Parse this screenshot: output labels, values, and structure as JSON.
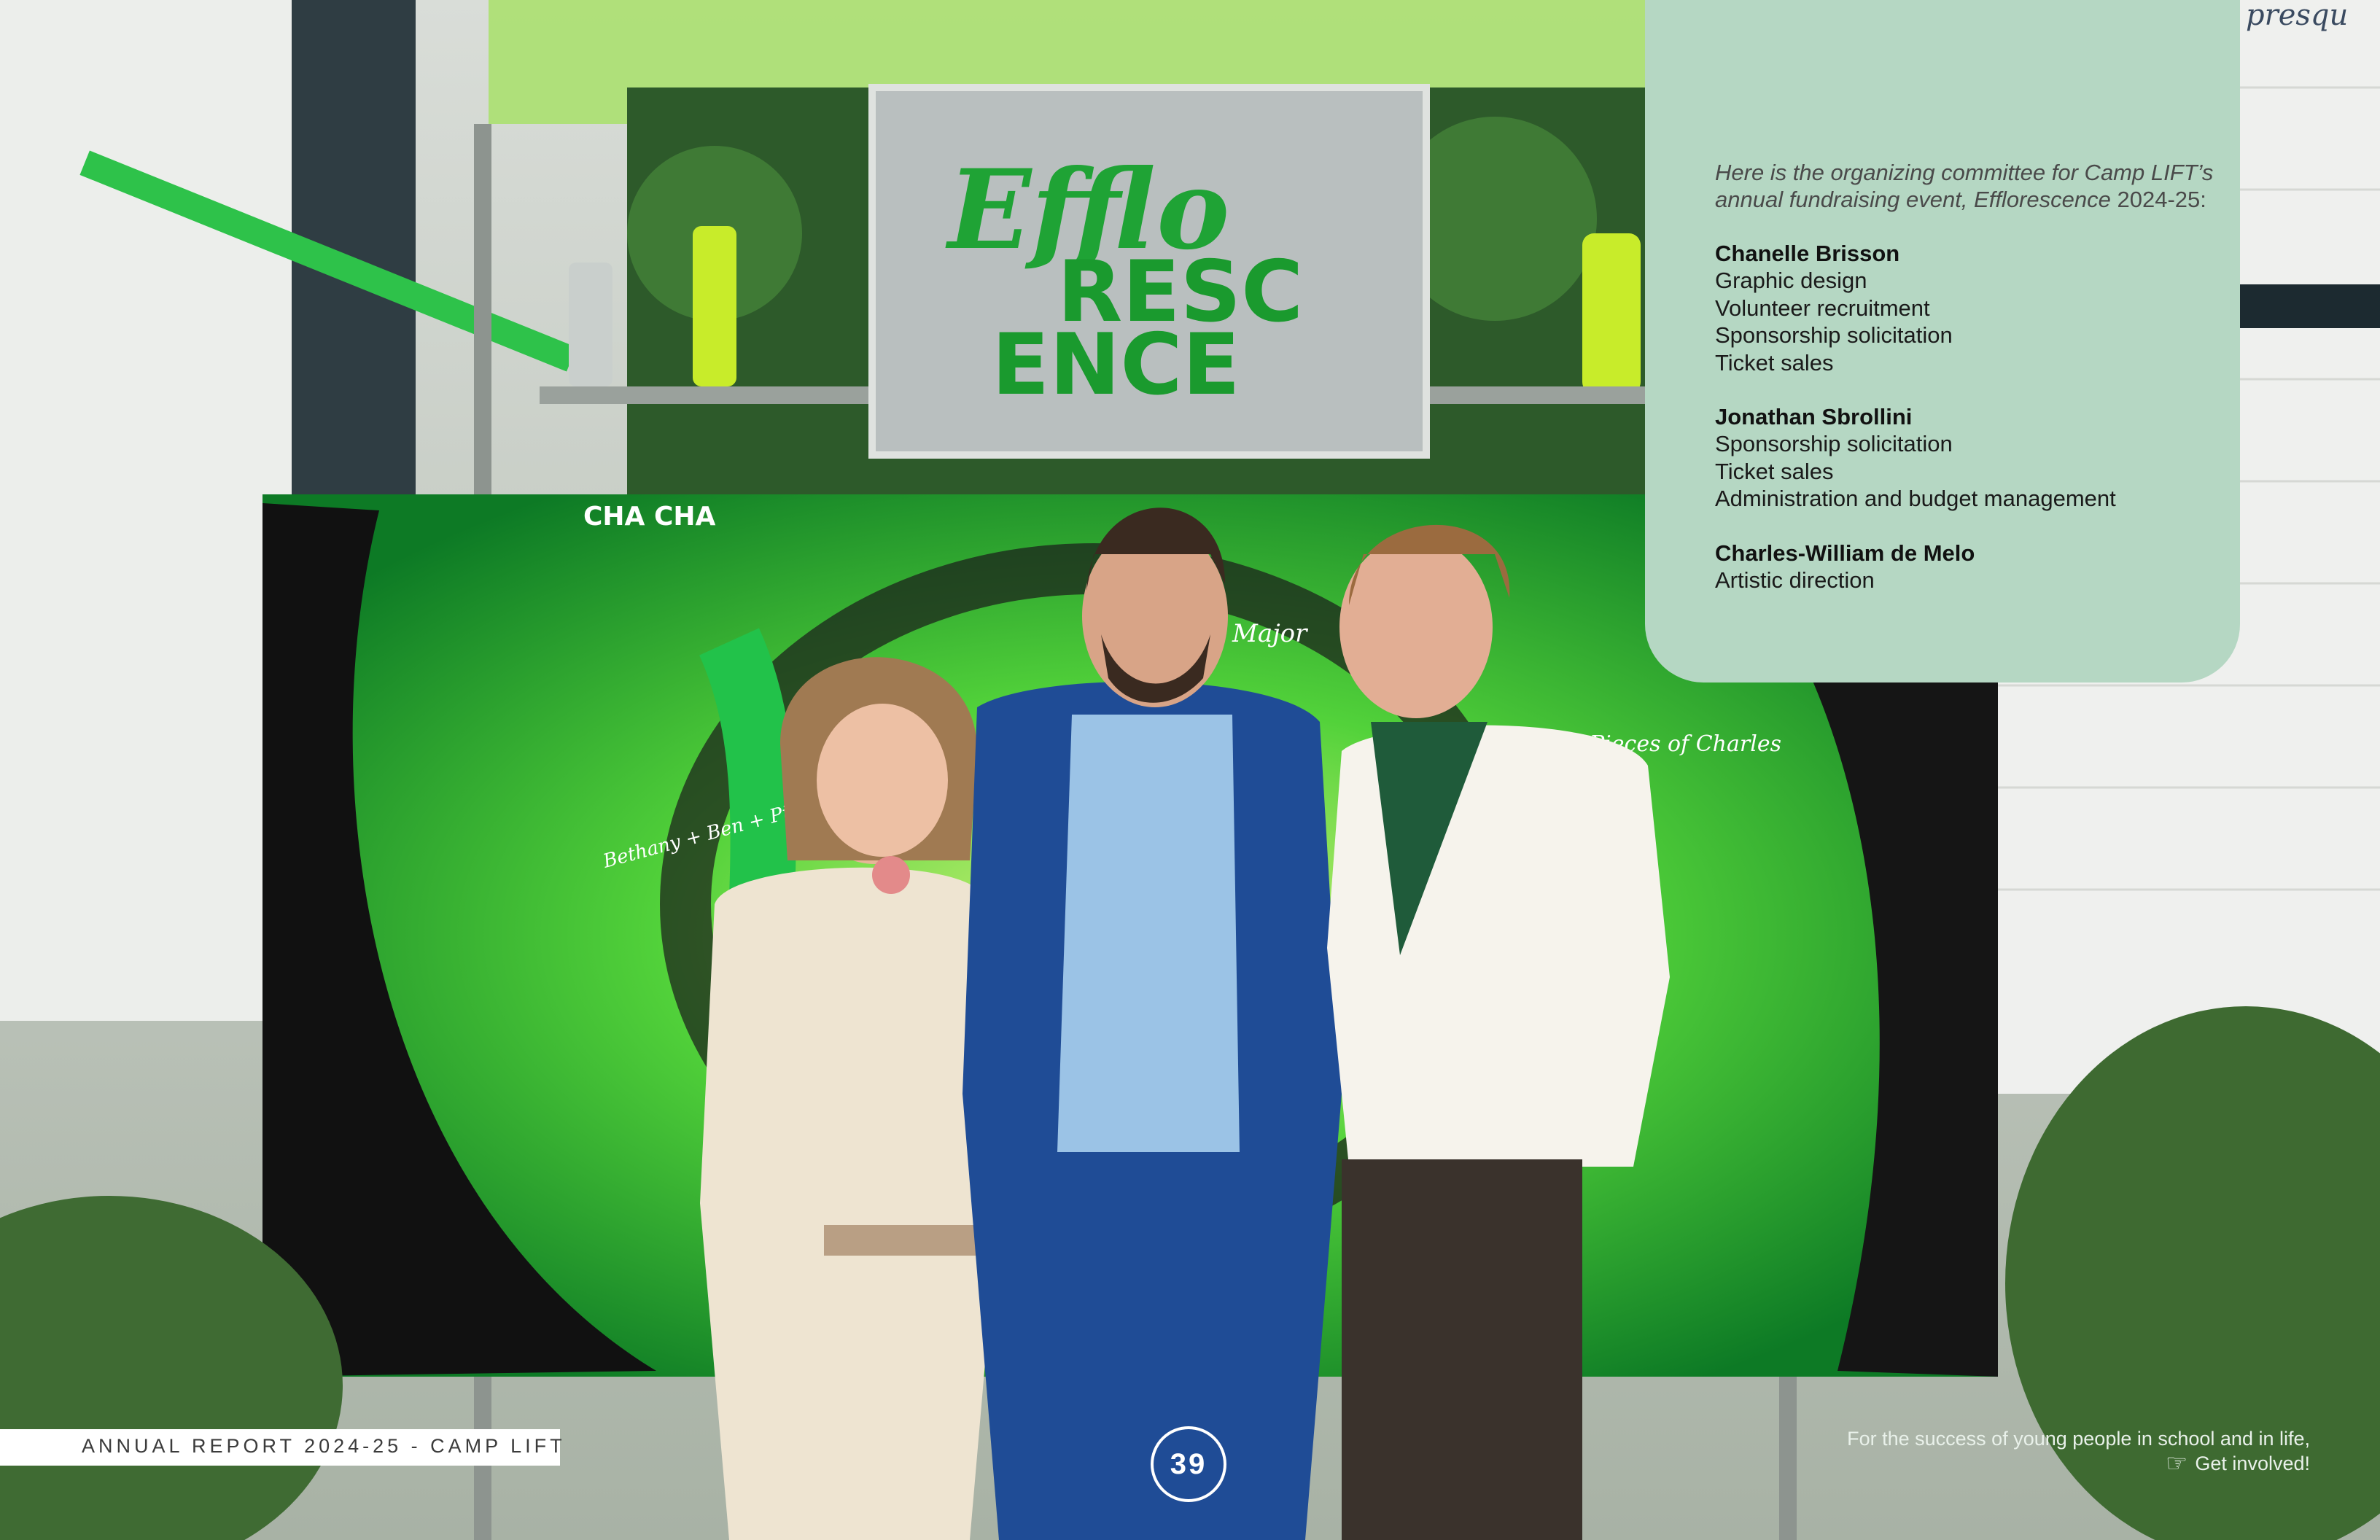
{
  "photo": {
    "sign_lines": [
      "Efflo",
      "RESC",
      "ENCE"
    ],
    "mural_tags": [
      "CHA CHA",
      "Major",
      "Pieces of Charles",
      "Bethany + Ben + Pippin"
    ],
    "wall_text": "presqu"
  },
  "panel": {
    "intro": "Here is the organizing committee for Camp LIFT’s annual fundraising event, Efflorescence",
    "intro_year": "2024-25:",
    "members": [
      {
        "name": "Chanelle Brisson",
        "roles": [
          "Graphic design",
          "Volunteer recruitment",
          "Sponsorship solicitation",
          "Ticket sales"
        ]
      },
      {
        "name": "Jonathan Sbrollini",
        "roles": [
          "Sponsorship solicitation",
          "Ticket sales",
          "Administration and budget management"
        ]
      },
      {
        "name": "Charles-William de Melo",
        "roles": [
          "Artistic direction"
        ]
      }
    ]
  },
  "footer": {
    "report_title": "ANNUAL REPORT 2024-25 - CAMP LIFT",
    "page_number": "39",
    "tagline": "For the success of young people in school and in life,",
    "cta": "Get involved!",
    "cta_icon": "pointing-hand-icon"
  },
  "colors": {
    "panel": "#b5d7c3",
    "sign_green": "#1fa335",
    "accent": "#ffffff"
  }
}
